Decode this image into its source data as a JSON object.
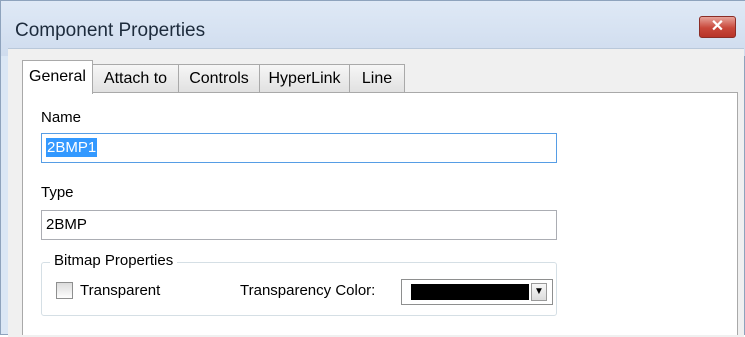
{
  "window": {
    "title": "Component Properties",
    "close_glyph": "✕"
  },
  "tabs": [
    {
      "label": "General",
      "active": true
    },
    {
      "label": "Attach to"
    },
    {
      "label": "Controls"
    },
    {
      "label": "HyperLink"
    },
    {
      "label": "Line"
    }
  ],
  "general": {
    "name_label": "Name",
    "name_value": "2BMP1",
    "type_label": "Type",
    "type_value": "2BMP",
    "bitmap_group_title": "Bitmap Properties",
    "transparent_label": "Transparent",
    "transparent_checked": false,
    "transparency_color_label": "Transparency Color:",
    "transparency_color": "#000000",
    "dropdown_icon": "chevron-down-icon"
  },
  "colors": {
    "accent_selection": "#3399ff",
    "close_button": "#c8473a"
  }
}
